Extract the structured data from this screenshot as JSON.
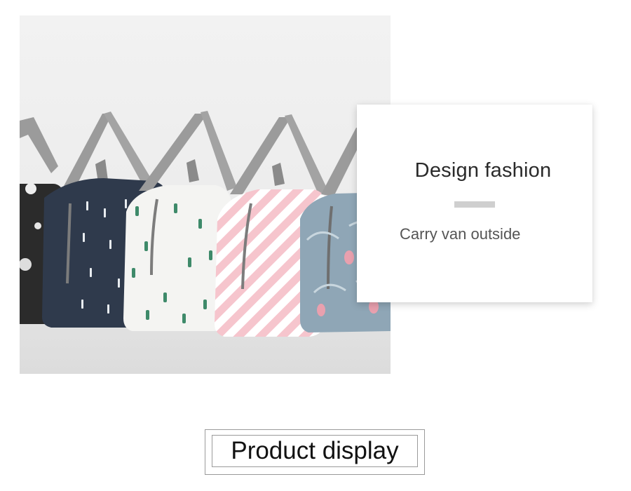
{
  "card": {
    "title": "Design fashion",
    "subtitle": "Carry van outside"
  },
  "badge": {
    "label": "Product display"
  },
  "photo": {
    "subject": "lunch-bags",
    "colors": {
      "background": "#ececec",
      "floor": "#dedede",
      "handle": "#9b9b9b",
      "black_bag": "#2b2b2b",
      "navy_bag": "#2f3a4c",
      "white_bag": "#f4f4f2",
      "pink_bag": "#f2a7b4",
      "blue_bag": "#8fa6b6",
      "zipper": "#7c7c7c"
    }
  }
}
